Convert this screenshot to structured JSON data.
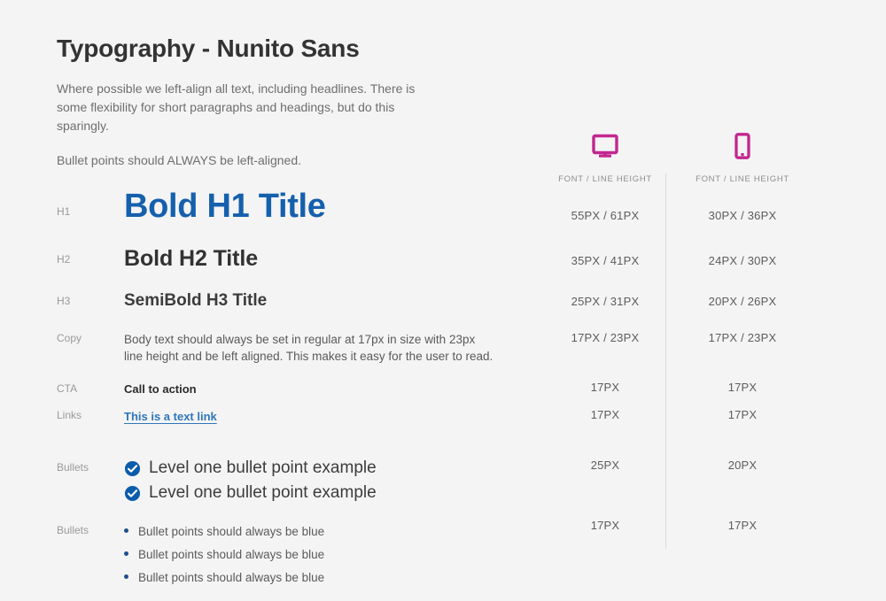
{
  "header": {
    "title": "Typography - Nunito Sans",
    "paragraph_1": "Where possible we left-align all text, including headlines. There is some flexibility for short paragraphs and headings, but do this sparingly.",
    "paragraph_2": "Bullet points should ALWAYS be left-aligned."
  },
  "columns": {
    "desktop": {
      "icon": "desktop-monitor-icon",
      "caption": "FONT / LINE HEIGHT"
    },
    "mobile": {
      "icon": "mobile-phone-icon",
      "caption": "FONT / LINE HEIGHT"
    }
  },
  "rows": {
    "h1": {
      "label": "H1",
      "sample": "Bold H1 Title",
      "desktop": "55PX / 61PX",
      "mobile": "30PX / 36PX"
    },
    "h2": {
      "label": "H2",
      "sample": "Bold H2 Title",
      "desktop": "35PX / 41PX",
      "mobile": "24PX / 30PX"
    },
    "h3": {
      "label": "H3",
      "sample": "SemiBold H3 Title",
      "desktop": "25PX / 31PX",
      "mobile": "20PX / 26PX"
    },
    "copy": {
      "label": "Copy",
      "sample": "Body text should always be set in regular at 17px in size with 23px line height and be left aligned. This makes it easy for the user to read.",
      "desktop": "17PX / 23PX",
      "mobile": "17PX / 23PX"
    },
    "cta": {
      "label": "CTA",
      "sample": "Call to action",
      "desktop": "17PX",
      "mobile": "17PX"
    },
    "links": {
      "label": "Links",
      "sample": "This is a text link",
      "desktop": "17PX",
      "mobile": "17PX"
    },
    "bullets_level_one": {
      "label": "Bullets",
      "items": [
        "Level one bullet point example",
        "Level one bullet point example"
      ],
      "desktop": "25PX",
      "mobile": "20PX"
    },
    "bullets_dots": {
      "label": "Bullets",
      "items": [
        "Bullet points should always be blue",
        "Bullet points should always be blue",
        "Bullet points should always be blue"
      ],
      "desktop": "17PX",
      "mobile": "17PX"
    }
  },
  "colors": {
    "background": "#f4f4f4",
    "h1_blue": "#1560ad",
    "link_blue": "#2e76bc",
    "bullet_blue": "#1d4f8c",
    "check_blue": "#0b5cab",
    "device_icon_magenta": "#c2268f",
    "divider_gray": "#dcdcdc",
    "label_gray": "#9a9a9a"
  }
}
